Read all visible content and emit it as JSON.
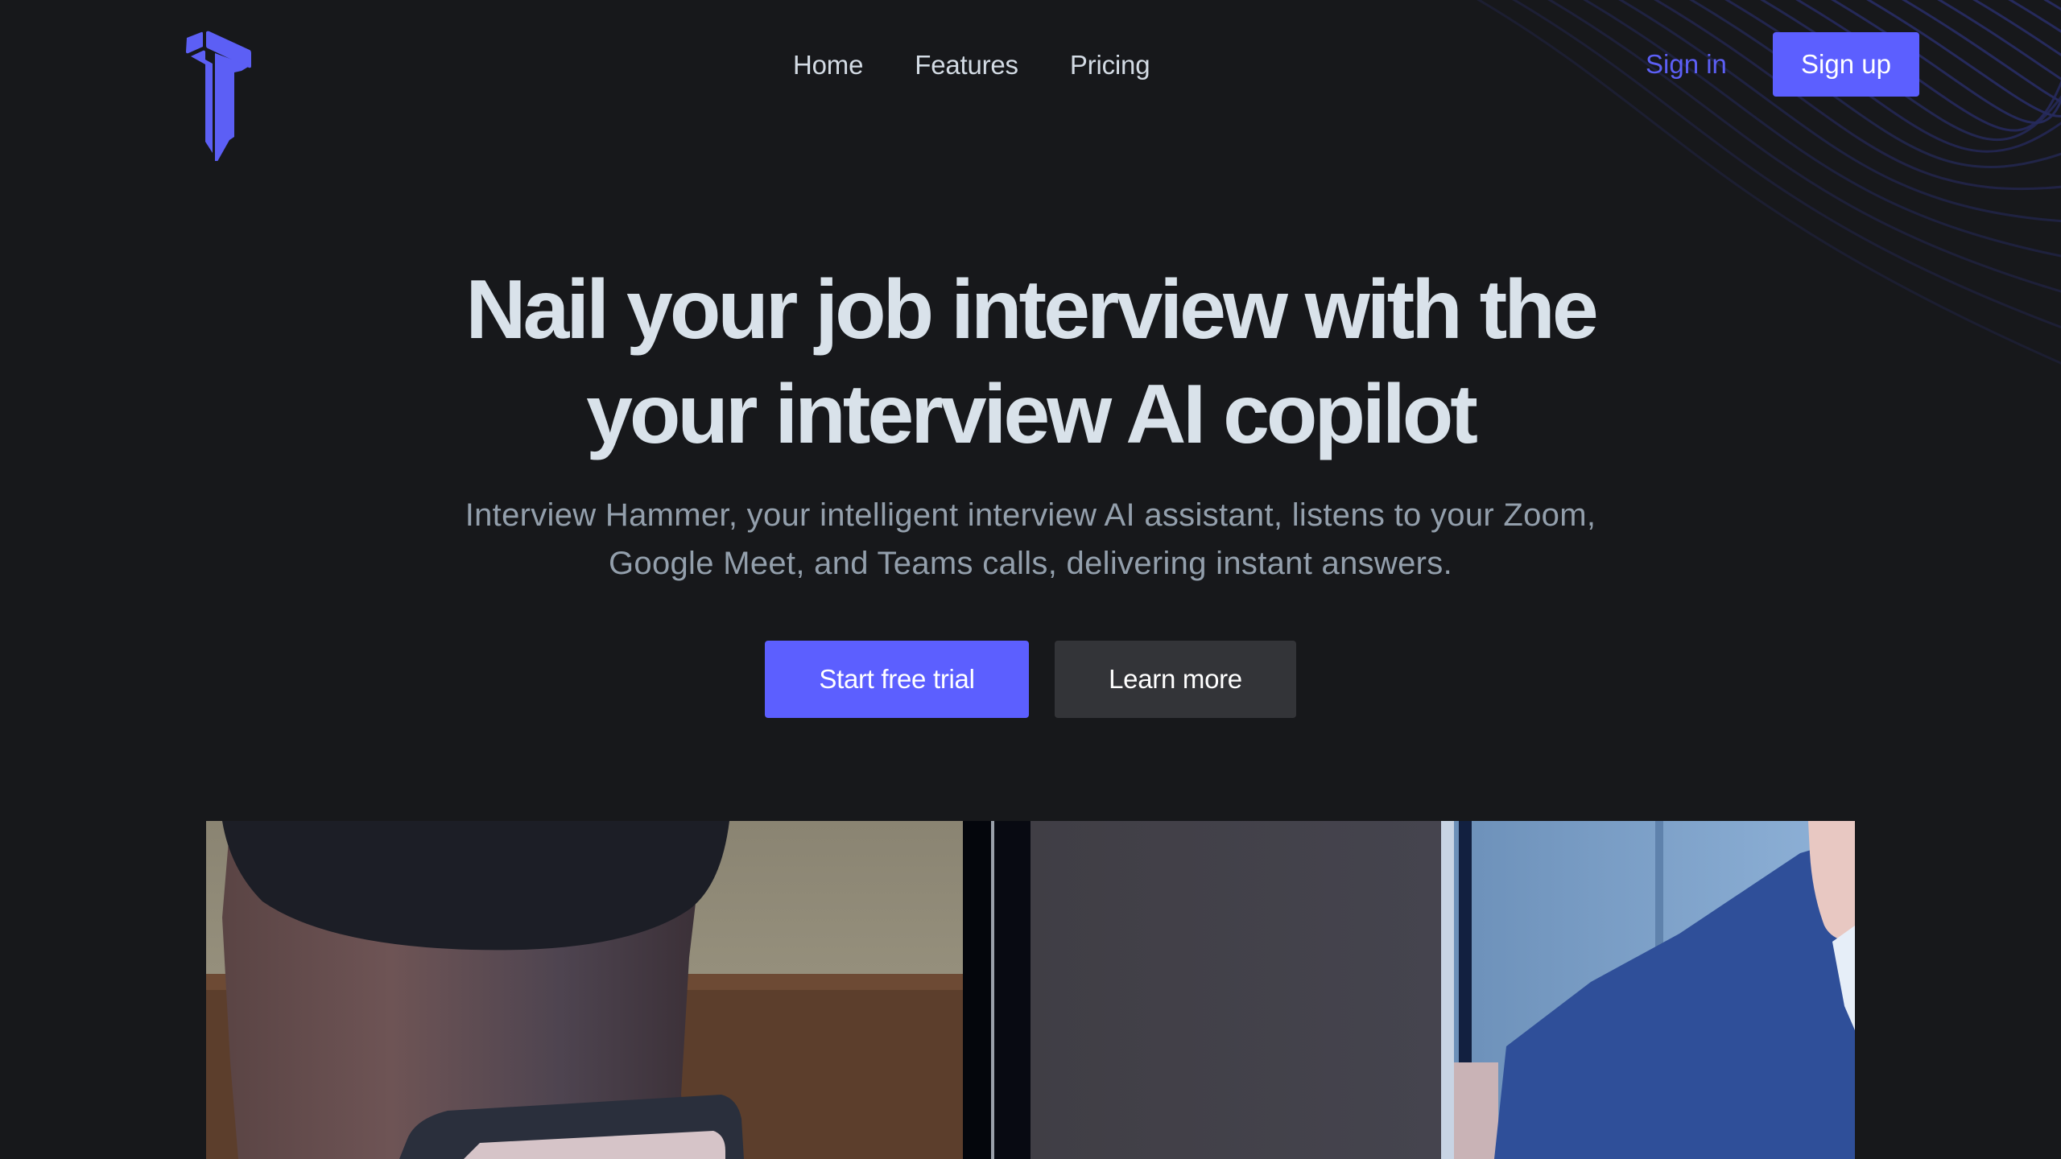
{
  "brand": {
    "logo_icon": "hammer-t-logo-icon",
    "accent_color": "#5c5fff"
  },
  "nav": {
    "links": [
      {
        "label": "Home"
      },
      {
        "label": "Features"
      },
      {
        "label": "Pricing"
      }
    ],
    "sign_in_label": "Sign in",
    "sign_up_label": "Sign up"
  },
  "hero": {
    "title_line1": "Nail your job interview with the",
    "title_line2": "your interview AI copilot",
    "subtitle_line1": "Interview Hammer, your intelligent interview AI assistant, listens to your Zoom,",
    "subtitle_line2": "Google Meet, and Teams calls, delivering instant answers.",
    "primary_cta_label": "Start free trial",
    "secondary_cta_label": "Learn more"
  },
  "media": {
    "description": "Demo video of a video-call interview"
  },
  "colors": {
    "background": "#17181b",
    "heading": "#d9e2ea",
    "subtitle": "#939fac",
    "nav_text": "#d3dbe4",
    "secondary_button": "#333438",
    "wave_lines": "#262a5c"
  }
}
